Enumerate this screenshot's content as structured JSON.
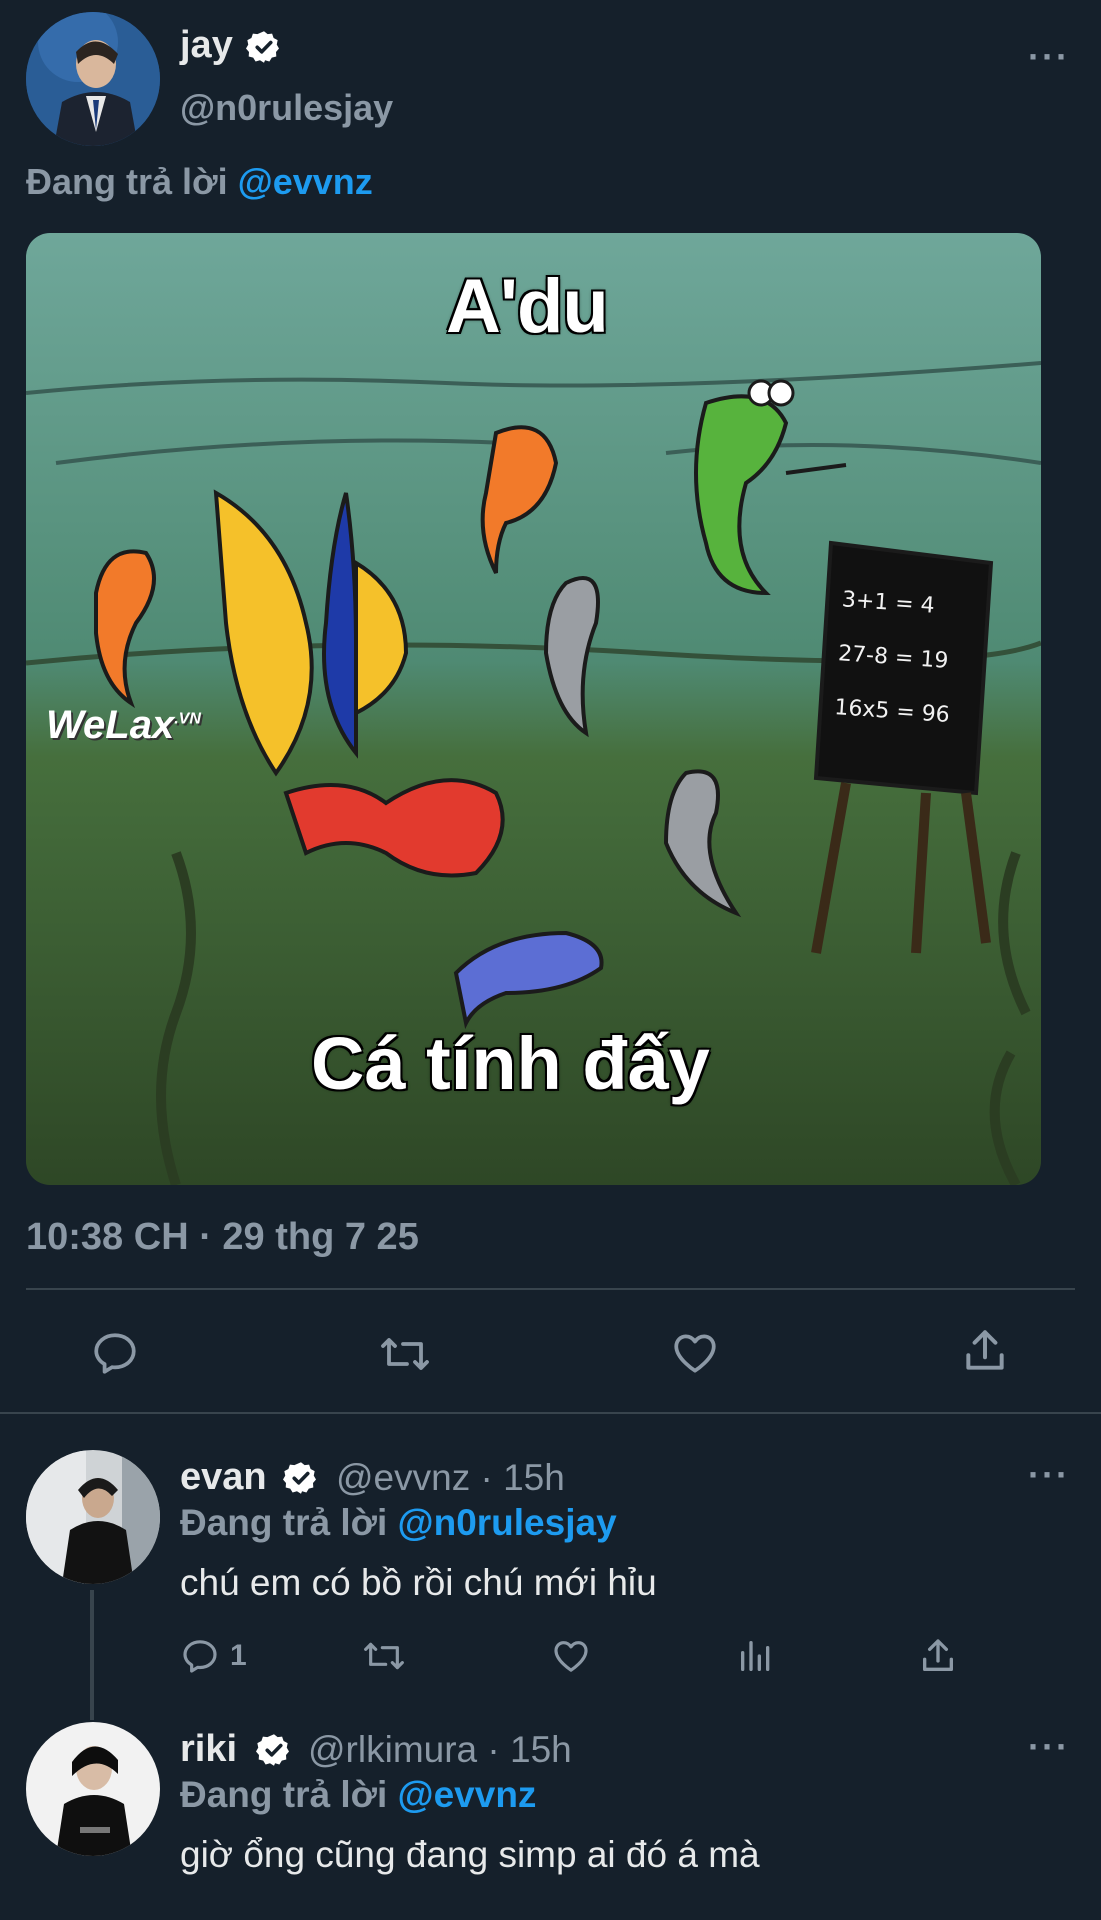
{
  "main_tweet": {
    "author_name": "jay",
    "handle": "@n0rulesjay",
    "replying_prefix": "Đang trả lời",
    "replying_to": "@evvnz",
    "image": {
      "top_caption": "A'du",
      "bottom_caption": "Cá tính đấy",
      "watermark": "WeLax",
      "watermark_sup": ".VN",
      "board_lines": [
        "3+1 = 4",
        "27-8 = 19",
        "16x5 = 96"
      ]
    },
    "timestamp": "10:38 CH · 29 thg 7 25",
    "actions": [
      {
        "icon": "reply-icon"
      },
      {
        "icon": "retweet-icon"
      },
      {
        "icon": "like-icon"
      },
      {
        "icon": "share-icon"
      }
    ]
  },
  "replies": [
    {
      "author_name": "evan",
      "handle": "@evvnz",
      "time": "· 15h",
      "replying_prefix": "Đang trả lời",
      "replying_to": "@n0rulesjay",
      "text": "chú em có bồ rồi chú mới hỉu",
      "reply_count": "1"
    },
    {
      "author_name": "riki",
      "handle": "@rlkimura",
      "time": "· 15h",
      "replying_prefix": "Đang trả lời",
      "replying_to": "@evvnz",
      "text": "giờ ổng cũng đang simp ai đó á mà"
    }
  ],
  "colors": {
    "background": "#15202b",
    "link": "#1d9bf0",
    "muted": "#8b98a5",
    "verified_badge": "#ffffff"
  }
}
